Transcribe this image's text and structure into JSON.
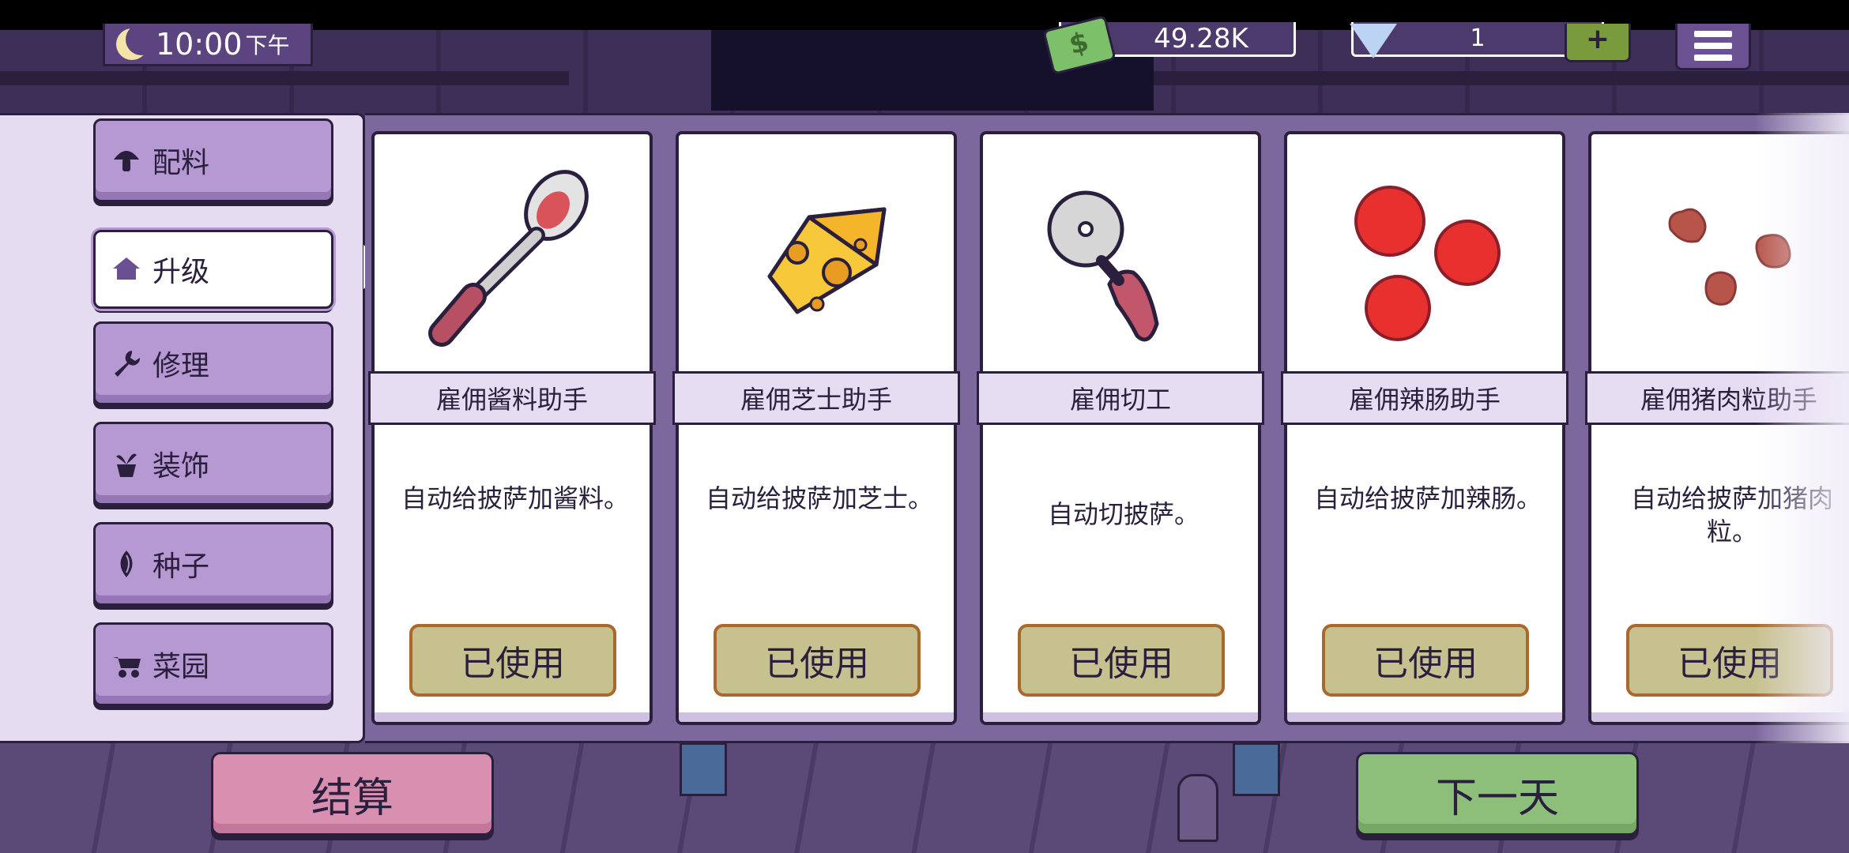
{
  "status_bar": {},
  "hud": {
    "time": "10:00",
    "ampm": "下午",
    "money": "49.28K",
    "gems": "1",
    "gem_plus": "+"
  },
  "sidebar": {
    "tabs": [
      {
        "label": "配料",
        "icon": "mushroom-icon",
        "active": false
      },
      {
        "label": "升级",
        "icon": "house-icon",
        "active": true
      },
      {
        "label": "修理",
        "icon": "wrench-icon",
        "active": false
      },
      {
        "label": "装饰",
        "icon": "potted-plant-icon",
        "active": false
      },
      {
        "label": "种子",
        "icon": "seed-icon",
        "active": false
      },
      {
        "label": "菜园",
        "icon": "wheelbarrow-icon",
        "active": false
      }
    ]
  },
  "cards": [
    {
      "title": "雇佣酱料助手",
      "desc": "自动给披萨加酱料。",
      "button": "已使用",
      "art": "sauce-spoon-icon"
    },
    {
      "title": "雇佣芝士助手",
      "desc": "自动给披萨加芝士。",
      "button": "已使用",
      "art": "cheese-icon"
    },
    {
      "title": "雇佣切工",
      "desc": "自动切披萨。",
      "button": "已使用",
      "art": "pizza-cutter-icon"
    },
    {
      "title": "雇佣辣肠助手",
      "desc": "自动给披萨加辣肠。",
      "button": "已使用",
      "art": "pepperoni-icon"
    },
    {
      "title": "雇佣猪肉粒助手",
      "desc": "自动给披萨加猪肉粒。",
      "button": "已使用",
      "art": "pork-bits-icon"
    }
  ],
  "bottom": {
    "checkout": "结算",
    "next_day": "下一天"
  },
  "colors": {
    "panel": "#e6dcf1",
    "tab": "#b698d2",
    "used_button": "#c7c08f",
    "checkout": "#d98fb0",
    "next_day": "#8dbf7a"
  }
}
